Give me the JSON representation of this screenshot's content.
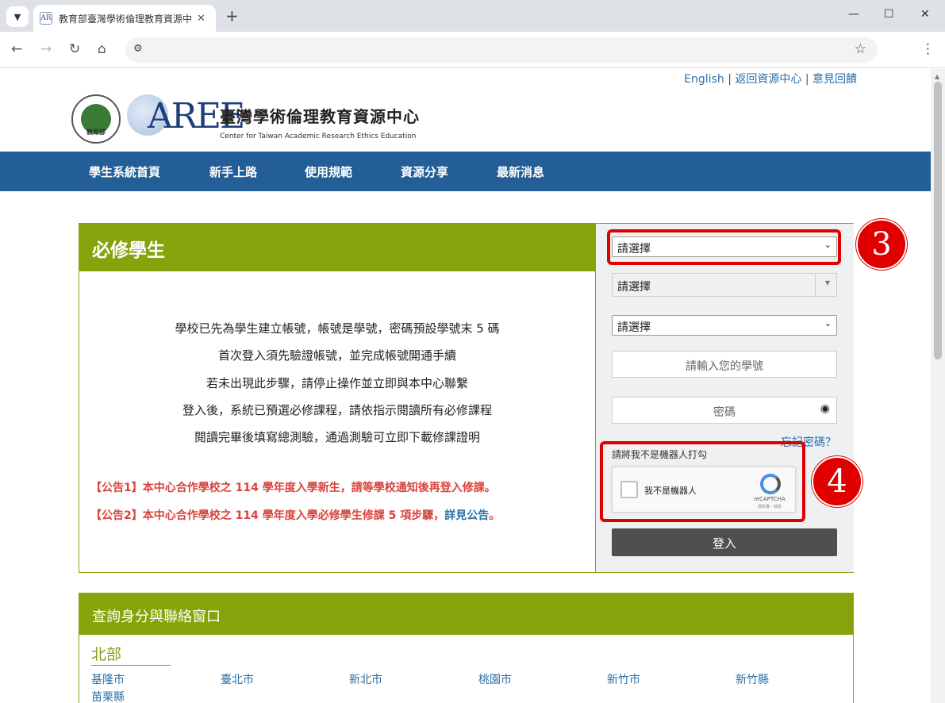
{
  "browser": {
    "tab_title": "教育部臺灣學術倫理教育資源中心",
    "tab_favicon": "AR",
    "new_tab": "+",
    "close_tab": "✕"
  },
  "toplinks": {
    "english": "English",
    "sep": "|",
    "back": "返回資源中心",
    "feedback": "意見回饋"
  },
  "logo": {
    "seal_text": "教育部",
    "mark": "AREE",
    "title_zh": "臺灣學術倫理教育資源中心",
    "title_en": "Center for Taiwan Academic Research Ethics Education"
  },
  "nav": [
    "學生系統首頁",
    "新手上路",
    "使用規範",
    "資源分享",
    "最新消息"
  ],
  "main": {
    "title": "必修學生",
    "info_lines": [
      "學校已先為學生建立帳號，帳號是學號，密碼預設學號末 5 碼",
      "首次登入須先驗證帳號，並完成帳號開通手續",
      "若未出現此步驟，請停止操作並立即與本中心聯繫",
      "登入後，系統已預選必修課程，請依指示閱讀所有必修課程",
      "閱讀完畢後填寫總測驗，通過測驗可立即下載修課證明"
    ],
    "announce1": "【公告1】本中心合作學校之 114 學年度入學新生，請等學校通知後再登入修課。",
    "announce2_prefix": "【公告2】本中心合作學校之 114 學年度入學必修學生修課 5 項步驟，",
    "announce2_link": "詳見公告",
    "announce2_suffix": "。"
  },
  "login": {
    "select1": "請選擇",
    "select2": "請選擇",
    "select3": "請選擇",
    "student_id_placeholder": "請輸入您的學號",
    "password_placeholder": "密碼",
    "forgot": "忘記密碼？",
    "captcha_label": "請將我不是機器人打勾",
    "captcha_text": "我不是機器人",
    "captcha_brand": "reCAPTCHA",
    "captcha_terms": "隱私權 - 條款",
    "submit": "登入"
  },
  "annotations": {
    "badge3": "3",
    "badge4": "4",
    "color": "#e00000"
  },
  "contact": {
    "title": "查詢身分與聯絡窗口",
    "region": "北部",
    "cities": [
      "基隆市",
      "臺北市",
      "新北市",
      "桃園市",
      "新竹市",
      "新竹縣",
      "苗栗縣"
    ]
  }
}
